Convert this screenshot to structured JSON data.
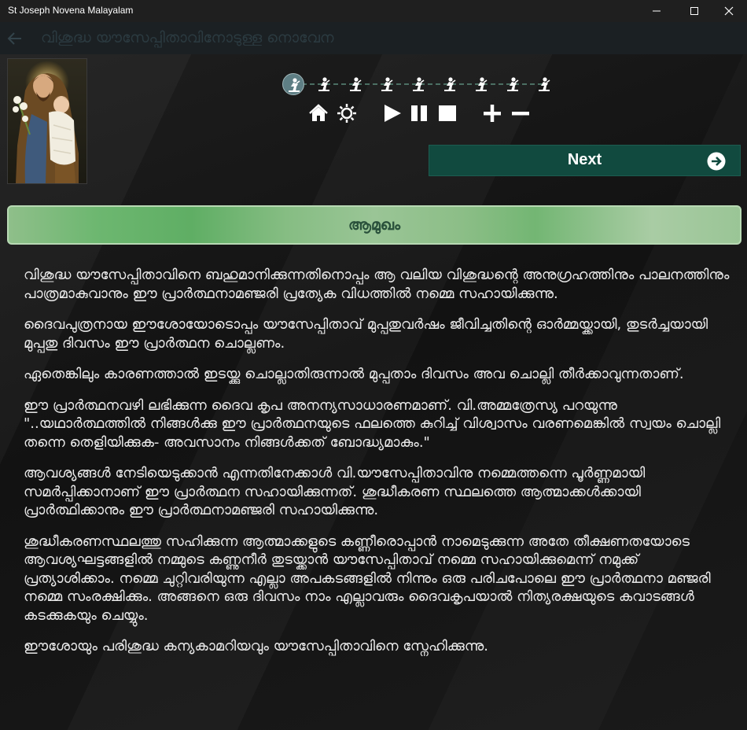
{
  "window": {
    "title": "St Joseph Novena Malayalam",
    "minimize_icon": "minimize-icon",
    "maximize_icon": "maximize-icon",
    "close_icon": "close-icon"
  },
  "header": {
    "back_icon": "back-arrow-icon",
    "title": "വിശുദ്ധ യൗസേപ്പിതാവിനോടുള്ള നൊവേന"
  },
  "progress": {
    "steps": 9,
    "current_step": 1,
    "step_icon": "praying-figure-icon"
  },
  "controls": {
    "home_icon": "home-icon",
    "settings_icon": "brightness-icon",
    "play_icon": "play-icon",
    "pause_icon": "pause-icon",
    "stop_icon": "stop-icon",
    "zoom_in_icon": "plus-icon",
    "zoom_out_icon": "minus-icon"
  },
  "next_button": {
    "label": "Next",
    "icon": "arrow-right-circle-icon"
  },
  "section": {
    "heading": "ആമുഖം"
  },
  "paragraphs": [
    "വിശുദ്ധ യൗസേപ്പിതാവിനെ ബഹുമാനിക്കുന്നതിനൊപ്പം ആ വലിയ വിശുദ്ധന്റെ അനുഗ്രഹത്തിനും പാലനത്തിനും പാത്രമാകുവാനും ഈ പ്രാർത്ഥനാമഞ്ജരി പ്രത്യേക വിധത്തിൽ നമ്മെ സഹായിക്കുന്നു.",
    "ദൈവപുത്രനായ ഈശോയോടൊപ്പം യൗസേപ്പിതാവ് മുപ്പതുവർഷം ജീവിച്ചതിന്റെ ഓർമ്മയ്ക്കായി, തുടർച്ചയായി മുപ്പതു ദിവസം ഈ പ്രാർത്ഥന ചൊല്ലണം.",
    "ഏതെങ്കിലും കാരണത്താൽ ഇടയ്ക്കു ചൊല്ലാതിരുന്നാൽ മുപ്പതാം ദിവസം അവ ചൊല്ലി തീർക്കാവുന്നതാണ്.",
    "ഈ പ്രാർത്ഥനവഴി ലഭിക്കുന്ന ദൈവ കൃപ അനന്യസാധാരണമാണ്. വി.അമ്മത്രേസ്യ പറയുന്നു \"..യഥാർത്ഥത്തിൽ നിങ്ങൾക്കു ഈ പ്രാർത്ഥനയുടെ ഫലത്തെ കുറിച്ച് വിശ്വാസം വരണമെങ്കിൽ സ്വയം ചൊല്ലി തന്നെ തെളിയിക്കുക- അവസാനം നിങ്ങൾക്കത് ബോദ്ധ്യമാകും.\"",
    "ആവശ്യങ്ങൾ നേടിയെടുക്കാൻ എന്നതിനേക്കാൾ വി.യൗസേപ്പിതാവിനു നമ്മെത്തന്നെ പൂർണ്ണമായി സമർപ്പിക്കാനാണ് ഈ പ്രാർത്ഥന സഹായിക്കുന്നത്. ശുദ്ധീകരണ സ്ഥലത്തെ ആത്മാക്കൾക്കായി പ്രാർത്ഥിക്കാനും ഈ പ്രാർത്ഥനാമഞ്ജരി സഹായിക്കുന്നു.",
    "ശുദ്ധീകരണസ്ഥലത്തു സഹിക്കുന്ന ആത്മാക്കളുടെ കണ്ണീരൊപ്പാൻ നാമെടുക്കുന്ന അതേ തീക്ഷണതയോടെ ആവശ്യഘട്ടങ്ങളിൽ നമ്മുടെ കണ്ണുനീർ തുടയ്ക്കാൻ യൗസേപ്പിതാവ് നമ്മെ സഹായിക്കുമെന്ന് നമുക്ക് പ്രത്യാശിക്കാം. നമ്മെ ചുറ്റിവരിയുന്ന എല്ലാ അപകടങ്ങളിൽ നിന്നും ഒരു പരിചപോലെ ഈ പ്രാർത്ഥനാ മഞ്ജരി നമ്മെ സംരക്ഷിക്കും. അങ്ങനെ ഒരു ദിവസം നാം എല്ലാവരും ദൈവകൃപയാൽ നിത്യരക്ഷയുടെ കവാടങ്ങൾ കടക്കുകയും ചെയ്യും.",
    "ഈശോയും പരിശുദ്ധ കന്യകാമറിയവും യൗസേപ്പിതാവിനെ സ്നേഹിക്കുന്നു."
  ]
}
